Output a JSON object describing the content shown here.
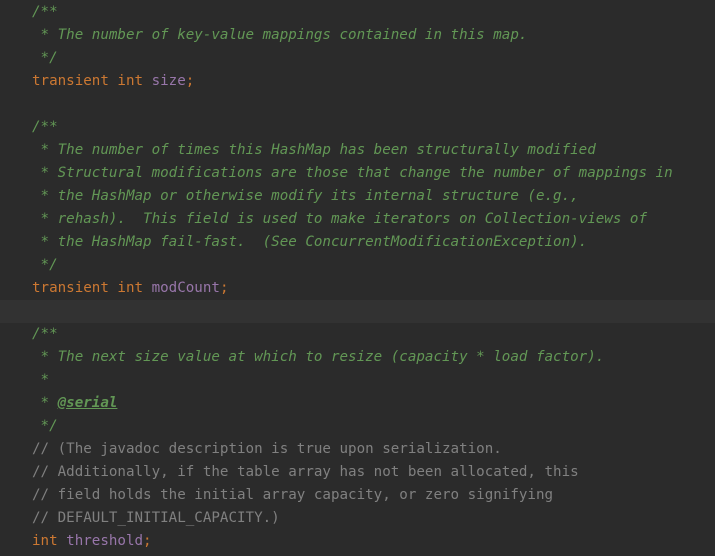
{
  "editor": {
    "lines": [
      {
        "doc": "/**"
      },
      {
        "doc": " * The number of key-value mappings contained in this map."
      },
      {
        "doc": " */"
      },
      {
        "kw1": "transient",
        "kw2": "int",
        "name": "size",
        "semi": ";"
      },
      {},
      {
        "doc": "/**"
      },
      {
        "doc": " * The number of times this HashMap has been structurally modified"
      },
      {
        "doc": " * Structural modifications are those that change the number of mappings in"
      },
      {
        "doc": " * the HashMap or otherwise modify its internal structure (e.g.,"
      },
      {
        "doc": " * rehash).  This field is used to make iterators on Collection-views of"
      },
      {
        "doc": " * the HashMap fail-fast.  (See ConcurrentModificationException)."
      },
      {
        "doc": " */"
      },
      {
        "kw1": "transient",
        "kw2": "int",
        "name": "modCount",
        "semi": ";"
      },
      {},
      {
        "doc": "/**"
      },
      {
        "doc": " * The next size value at which to resize (capacity * load factor)."
      },
      {
        "doc": " *"
      },
      {
        "doc": " * ",
        "tag": "@serial"
      },
      {
        "doc": " */"
      },
      {
        "comment": "// (The javadoc description is true upon serialization."
      },
      {
        "comment": "// Additionally, if the table array has not been allocated, this"
      },
      {
        "comment": "// field holds the initial array capacity, or zero signifying"
      },
      {
        "comment": "// DEFAULT_INITIAL_CAPACITY.)"
      },
      {
        "kw2": "int",
        "name": "threshold",
        "semi": ";"
      }
    ],
    "current_line_index": 13
  }
}
